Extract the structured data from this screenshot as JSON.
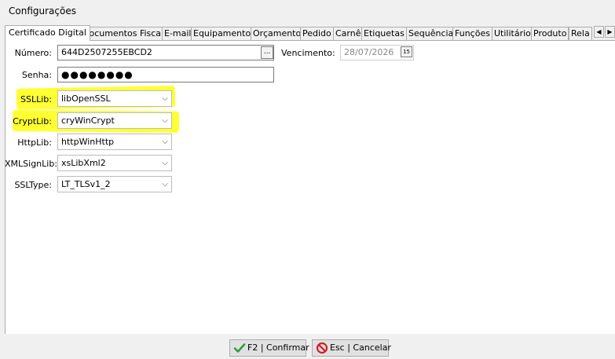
{
  "window": {
    "title": "Configurações"
  },
  "tabs": [
    "Certificado Digital",
    "Documentos Fiscais",
    "E-mail",
    "Equipamentos",
    "Orçamento",
    "Pedido",
    "Carnê",
    "Etiquetas",
    "Sequência",
    "Funções",
    "Utilitário",
    "Produto",
    "Rela"
  ],
  "form": {
    "numero_label": "Número:",
    "numero_value": "644D2507255EBCD2",
    "ellipsis_label": "...",
    "vencimento_label": "Vencimento:",
    "vencimento_value": "28/07/2026",
    "calendar_label": "15",
    "senha_label": "Senha:",
    "senha_value": "●●●●●●●●",
    "ssllib_label": "SSLLib:",
    "ssllib_value": "libOpenSSL",
    "cryptlib_label": "CryptLib:",
    "cryptlib_value": "cryWinCrypt",
    "httplib_label": "HttpLib:",
    "httplib_value": "httpWinHttp",
    "xmlsignlib_label": "XMLSignLib:",
    "xmlsignlib_value": "xsLibXml2",
    "ssltype_label": "SSLType:",
    "ssltype_value": "LT_TLSv1_2"
  },
  "buttons": {
    "confirm": "F2 | Confirmar",
    "cancel": "Esc | Cancelar"
  },
  "colors": {
    "highlight": "#ffff33",
    "confirm_icon": "#2e9e3e",
    "cancel_icon": "#d0202a"
  }
}
